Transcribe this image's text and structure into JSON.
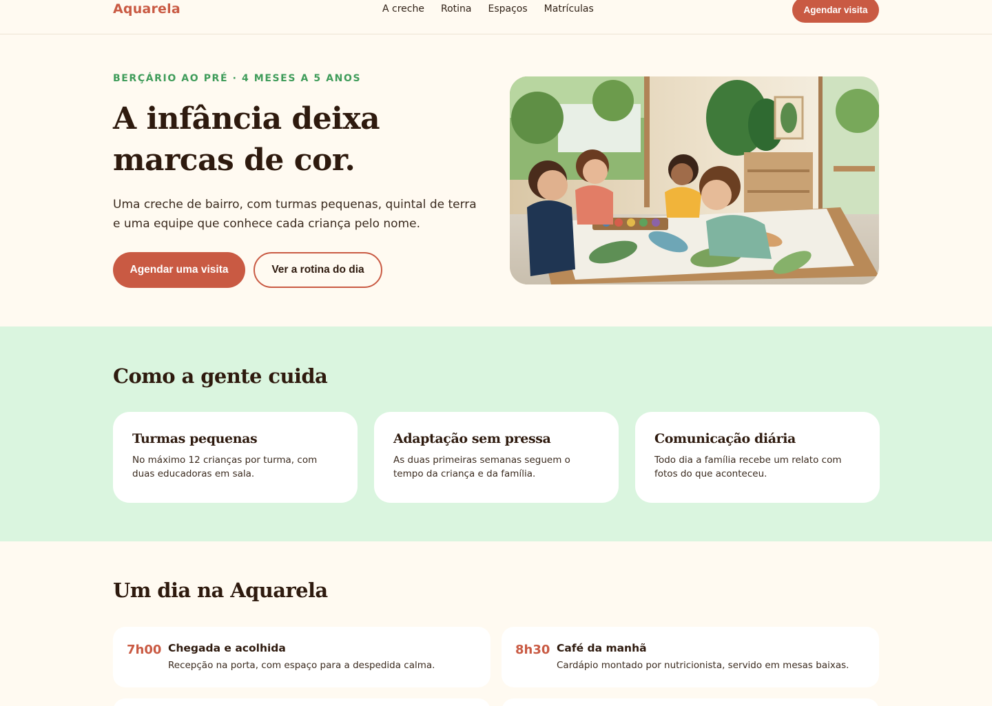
{
  "header": {
    "logo": "Aquarela",
    "nav": [
      "A creche",
      "Rotina",
      "Espaços",
      "Matrículas"
    ],
    "cta": "Agendar visita"
  },
  "hero": {
    "eyebrow": "BERÇÁRIO AO PRÉ · 4 MESES A 5 ANOS",
    "title": "A infância deixa marcas de cor.",
    "lead": "Uma creche de bairro, com turmas pequenas, quintal de terra e uma equipe que conhece cada criança pelo nome.",
    "primary_cta": "Agendar uma visita",
    "secondary_cta": "Ver a rotina do dia"
  },
  "care": {
    "title": "Como a gente cuida",
    "cards": [
      {
        "title": "Turmas pequenas",
        "text": "No máximo 12 crianças por turma, com duas educadoras em sala."
      },
      {
        "title": "Adaptação sem pressa",
        "text": "As duas primeiras semanas seguem o tempo da criança e da família."
      },
      {
        "title": "Comunicação diária",
        "text": "Todo dia a família recebe um relato com fotos do que aconteceu."
      }
    ]
  },
  "day": {
    "title": "Um dia na Aquarela",
    "items": [
      {
        "time": "7h00",
        "name": "Chegada e acolhida",
        "desc": "Recepção na porta, com espaço para a despedida calma."
      },
      {
        "time": "8h30",
        "name": "Café da manhã",
        "desc": "Cardápio montado por nutricionista, servido em mesas baixas."
      }
    ]
  },
  "colors": {
    "accent": "#c95a43",
    "eyebrow_green": "#3f9c5a",
    "band_green": "#daf5df",
    "page_bg": "#fffaf1",
    "heading": "#2e1a0e"
  }
}
